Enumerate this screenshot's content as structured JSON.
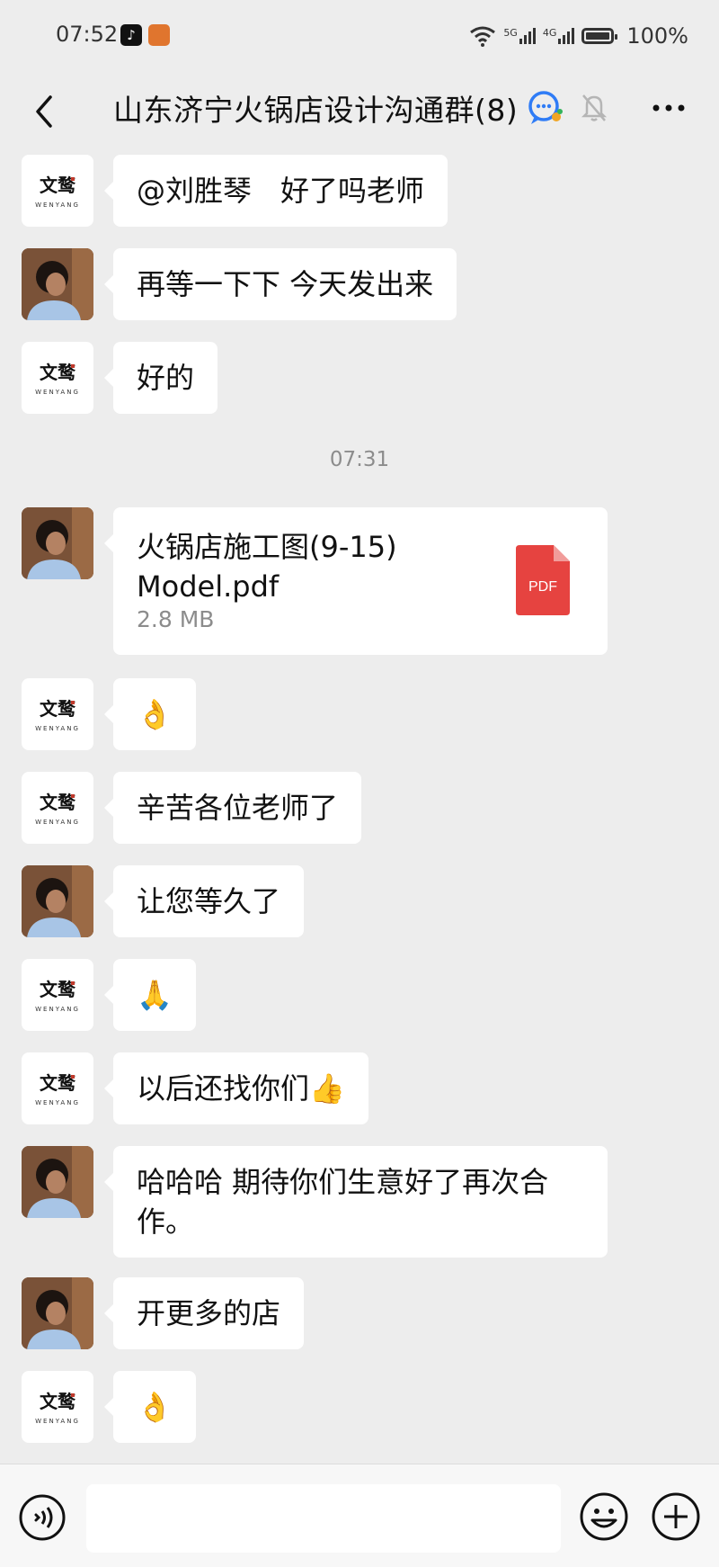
{
  "status_bar": {
    "time": "07:52",
    "network_5g": "5G",
    "network_4g": "4G",
    "battery": "100%"
  },
  "header": {
    "title": "山东济宁火锅店设计沟通群(8)"
  },
  "avatars": {
    "brand_logo_cn": "文鹜",
    "brand_logo_en": "WENYANG"
  },
  "messages": [
    {
      "sender": "brand",
      "text": "@刘胜琴　好了吗老师"
    },
    {
      "sender": "designer",
      "text": "再等一下下 今天发出来"
    },
    {
      "sender": "brand",
      "text": "好的"
    },
    {
      "timestamp": "07:31"
    },
    {
      "sender": "designer",
      "file": {
        "name": "火锅店施工图(9-15) Model.pdf",
        "size": "2.8 MB",
        "type_label": "PDF"
      }
    },
    {
      "sender": "brand",
      "text": "👌"
    },
    {
      "sender": "brand",
      "text": "辛苦各位老师了"
    },
    {
      "sender": "designer",
      "text": "让您等久了"
    },
    {
      "sender": "brand",
      "text": "🙏"
    },
    {
      "sender": "brand",
      "text": "以后还找你们👍"
    },
    {
      "sender": "designer",
      "text": "哈哈哈 期待你们生意好了再次合作。"
    },
    {
      "sender": "designer",
      "text": "开更多的店"
    },
    {
      "sender": "brand",
      "text": "👌"
    }
  ],
  "input_bar": {
    "placeholder": ""
  },
  "colors": {
    "background": "#ededed",
    "bubble": "#ffffff",
    "pdf_red": "#e64340",
    "timestamp": "#8c8c8c"
  }
}
